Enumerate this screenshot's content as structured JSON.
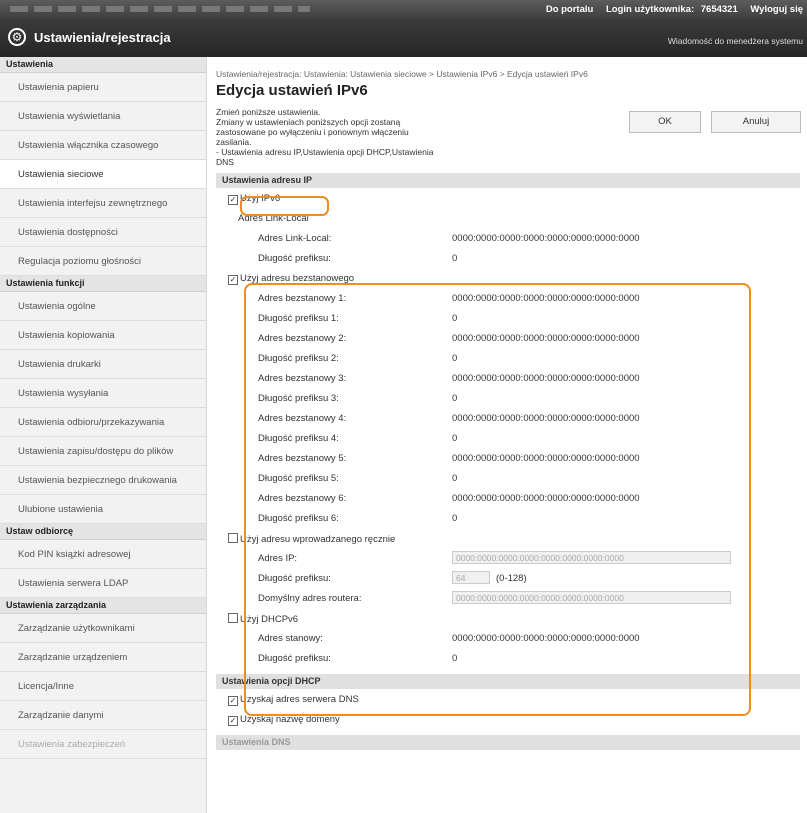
{
  "topbar": {
    "portal_link": "Do portalu",
    "login_label": "Login użytkownika:",
    "login_value": "7654321",
    "logout_link": "Wyloguj się"
  },
  "header": {
    "title": "Ustawienia/rejestracja",
    "message": "Wiadomość do menedżera systemu"
  },
  "sidebar": {
    "sections": [
      {
        "head": "Ustawienia",
        "items": [
          "Ustawienia papieru",
          "Ustawienia wyświetlania",
          "Ustawienia włącznika czasowego",
          "Ustawienia sieciowe",
          "Ustawienia interfejsu zewnętrznego",
          "Ustawienia dostępności",
          "Regulacja poziomu głośności"
        ]
      },
      {
        "head": "Ustawienia funkcji",
        "items": [
          "Ustawienia ogólne",
          "Ustawienia kopiowania",
          "Ustawienia drukarki",
          "Ustawienia wysyłania",
          "Ustawienia odbioru/przekazywania",
          "Ustawienia zapisu/dostępu do plików",
          "Ustawienia bezpiecznego drukowania",
          "Ulubione ustawienia"
        ]
      },
      {
        "head": "Ustaw odbiorcę",
        "items": [
          "Kod PIN książki adresowej",
          "Ustawienia serwera LDAP"
        ]
      },
      {
        "head": "Ustawienia zarządzania",
        "items": [
          "Zarządzanie użytkownikami",
          "Zarządzanie urządzeniem",
          "Licencja/Inne",
          "Zarządzanie danymi",
          "Ustawienia zabezpieczeń"
        ]
      }
    ]
  },
  "main": {
    "breadcrumb": "Ustawienia/rejestracja: Ustawienia: Ustawienia sieciowe > Ustawienia IPv6 > Edycja ustawień IPv6",
    "title": "Edycja ustawień IPv6",
    "intro": [
      "Zmień poniższe ustawienia.",
      "Zmiany w ustawieniach poniższych opcji zostaną zastosowane po wyłączeniu i ponownym włączeniu zasilania.",
      "- Ustawienia adresu IP,Ustawienia opcji DHCP,Ustawienia DNS"
    ],
    "ok_label": "OK",
    "cancel_label": "Anuluj",
    "ip_section": {
      "title": "Ustawienia adresu IP",
      "use_ipv6": "Użyj IPv6",
      "link_local_head": "Adres Link-Local",
      "link_local_rows": [
        {
          "label": "Adres Link-Local:",
          "value": "0000:0000:0000:0000:0000:0000:0000:0000"
        },
        {
          "label": "Długość prefiksu:",
          "value": "0"
        }
      ],
      "stateless_label": "Użyj adresu bezstanowego",
      "stateless_rows": [
        {
          "label": "Adres bezstanowy 1:",
          "value": "0000:0000:0000:0000:0000:0000:0000:0000"
        },
        {
          "label": "Długość prefiksu 1:",
          "value": "0"
        },
        {
          "label": "Adres bezstanowy 2:",
          "value": "0000:0000:0000:0000:0000:0000:0000:0000"
        },
        {
          "label": "Długość prefiksu 2:",
          "value": "0"
        },
        {
          "label": "Adres bezstanowy 3:",
          "value": "0000:0000:0000:0000:0000:0000:0000:0000"
        },
        {
          "label": "Długość prefiksu 3:",
          "value": "0"
        },
        {
          "label": "Adres bezstanowy 4:",
          "value": "0000:0000:0000:0000:0000:0000:0000:0000"
        },
        {
          "label": "Długość prefiksu 4:",
          "value": "0"
        },
        {
          "label": "Adres bezstanowy 5:",
          "value": "0000:0000:0000:0000:0000:0000:0000:0000"
        },
        {
          "label": "Długość prefiksu 5:",
          "value": "0"
        },
        {
          "label": "Adres bezstanowy 6:",
          "value": "0000:0000:0000:0000:0000:0000:0000:0000"
        },
        {
          "label": "Długość prefiksu 6:",
          "value": "0"
        }
      ],
      "manual_label": "Użyj adresu wprowadzanego ręcznie",
      "manual_ip_label": "Adres IP:",
      "manual_ip_value": "0000:0000:0000:0000:0000:0000:0000:0000",
      "manual_prefix_label": "Długość prefiksu:",
      "manual_prefix_value": "64",
      "manual_prefix_range": "(0-128)",
      "manual_router_label": "Domyślny adres routera:",
      "manual_router_value": "0000:0000:0000:0000:0000:0000:0000:0000",
      "dhcp_label": "Użyj DHCPv6",
      "dhcp_rows": [
        {
          "label": "Adres stanowy:",
          "value": "0000:0000:0000:0000:0000:0000:0000:0000"
        },
        {
          "label": "Długość prefiksu:",
          "value": "0"
        }
      ]
    },
    "dhcp_section": {
      "title": "Ustawienia opcji DHCP",
      "dns_server": "Uzyskaj adres serwera DNS",
      "domain_name": "Uzyskaj nazwę domeny"
    },
    "dns_section": {
      "title": "Ustawienia DNS"
    }
  }
}
